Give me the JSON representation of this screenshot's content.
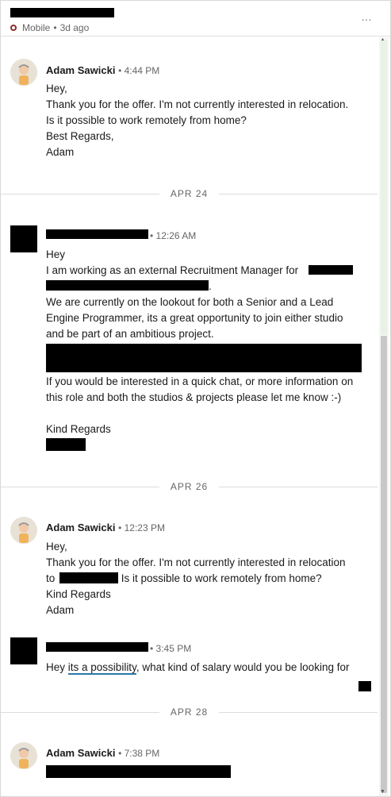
{
  "header": {
    "status_text": "Mobile",
    "separator": "•",
    "ago": "3d ago",
    "more_label": "…"
  },
  "messages": [
    {
      "sender": "Adam Sawicki",
      "time": "4:44 PM",
      "lines": [
        "Hey,",
        "Thank you for the offer. I'm not currently interested in relocation.",
        "Is it possible to work remotely from home?",
        "Best Regards,",
        "Adam"
      ]
    },
    {
      "sender": "",
      "time": "12:26 AM",
      "lines": [
        "Hey",
        "I am working as an external Recruitment Manager for",
        ".",
        "We are currently on the lookout for both a Senior and a Lead",
        "Engine Programmer, its a great opportunity to join either studio",
        "and be part of an ambitious project.",
        "If you would be interested in a quick chat, or more information on",
        "this role and both the studios & projects please let me know :-)",
        "Kind Regards"
      ]
    },
    {
      "sender": "Adam Sawicki",
      "time": "12:23 PM",
      "lines": [
        "Hey,",
        "Thank you for the offer. I'm not currently interested in relocation",
        "to",
        ". Is it possible to work remotely from home?",
        "Kind Regards",
        "Adam"
      ]
    },
    {
      "sender": "",
      "time": "3:45 PM",
      "lines": [
        "Hey",
        "its a possibility",
        ", what kind of salary would you be looking for"
      ]
    },
    {
      "sender": "Adam Sawicki",
      "time": "7:38 PM",
      "lines": []
    }
  ],
  "dates": [
    "APR 24",
    "APR 26",
    "APR 28"
  ],
  "time_bullet": "•"
}
